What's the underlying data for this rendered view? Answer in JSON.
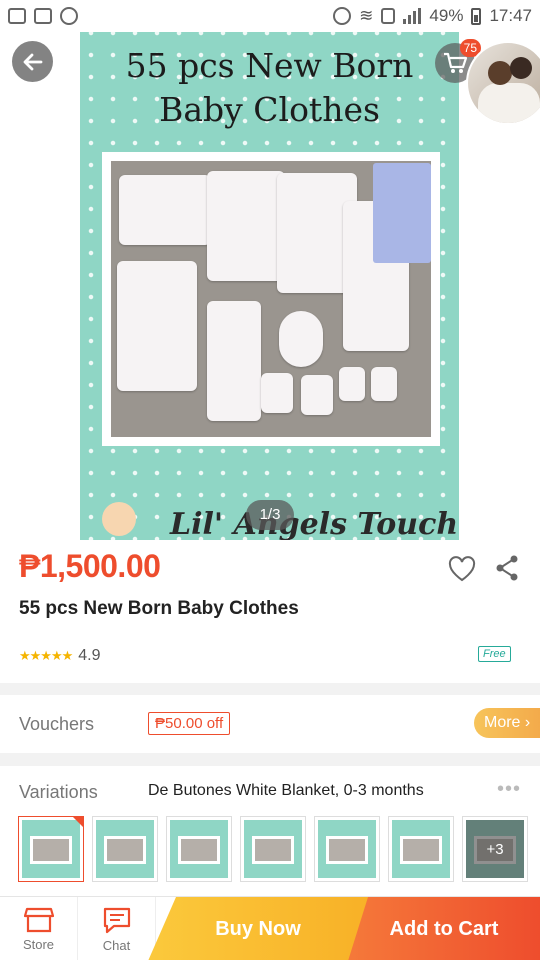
{
  "status_bar": {
    "battery": "49%",
    "time": "17:47"
  },
  "hero": {
    "image_title_line1": "55 pcs New Born",
    "image_title_line2": "Baby Clothes",
    "image_brand": "Lil' Angels Touch",
    "pager": "1/3",
    "cart_count": "75"
  },
  "product": {
    "price": "₱1,500.00",
    "title": "55 pcs New Born Baby Clothes",
    "stars": "★★★★★",
    "rating": "4.9",
    "free_shipping": "Free"
  },
  "vouchers": {
    "label": "Vouchers",
    "tag": "₱50.00 off",
    "more": "More"
  },
  "variations": {
    "label": "Variations",
    "selected": "De Butones White Blanket, 0-3 months",
    "more_count": "+3"
  },
  "bottom_bar": {
    "store": "Store",
    "chat": "Chat",
    "buy_now": "Buy Now",
    "add_to_cart": "Add to Cart"
  },
  "colors": {
    "accent": "#ee4d2d",
    "buy_now": "#f8b127",
    "image_bg": "#8fd6c5"
  }
}
